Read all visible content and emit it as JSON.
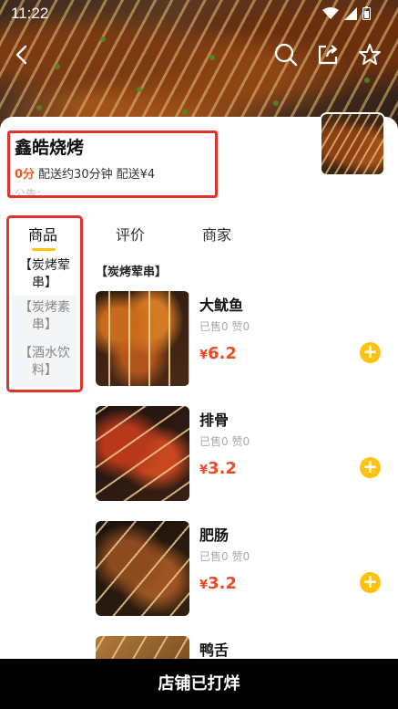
{
  "status_bar": {
    "time": "11:22"
  },
  "shop": {
    "name": "鑫皓烧烤",
    "score": "0分",
    "delivery_time": "配送约30分钟",
    "delivery_fee": "配送¥4",
    "notice": "公告："
  },
  "tabs": [
    {
      "label": "商品",
      "active": true
    },
    {
      "label": "评价",
      "active": false
    },
    {
      "label": "商家",
      "active": false
    }
  ],
  "categories": [
    {
      "label": "【炭烤荤串】",
      "active": true
    },
    {
      "label": "【炭烤素串】",
      "active": false
    },
    {
      "label": "【酒水饮料】",
      "active": false
    }
  ],
  "section_title": "【炭烤荤串】",
  "products": [
    {
      "name": "大鱿鱼",
      "sold": "已售0",
      "likes": "赞0",
      "currency": "¥",
      "price": "6.2"
    },
    {
      "name": "排骨",
      "sold": "已售0",
      "likes": "赞0",
      "currency": "¥",
      "price": "3.2"
    },
    {
      "name": "肥肠",
      "sold": "已售0",
      "likes": "赞0",
      "currency": "¥",
      "price": "3.2"
    },
    {
      "name": "鸭舌"
    }
  ],
  "bottom_bar": {
    "label": "店铺已打烊"
  },
  "icons": {
    "back": "back-arrow-icon",
    "search": "search-icon",
    "share": "share-icon",
    "favorite": "star-icon",
    "add": "plus-icon"
  },
  "colors": {
    "accent": "#ffc20e",
    "price": "#f04a22",
    "highlight_box": "#e2332a",
    "score": "#f35a1d"
  }
}
